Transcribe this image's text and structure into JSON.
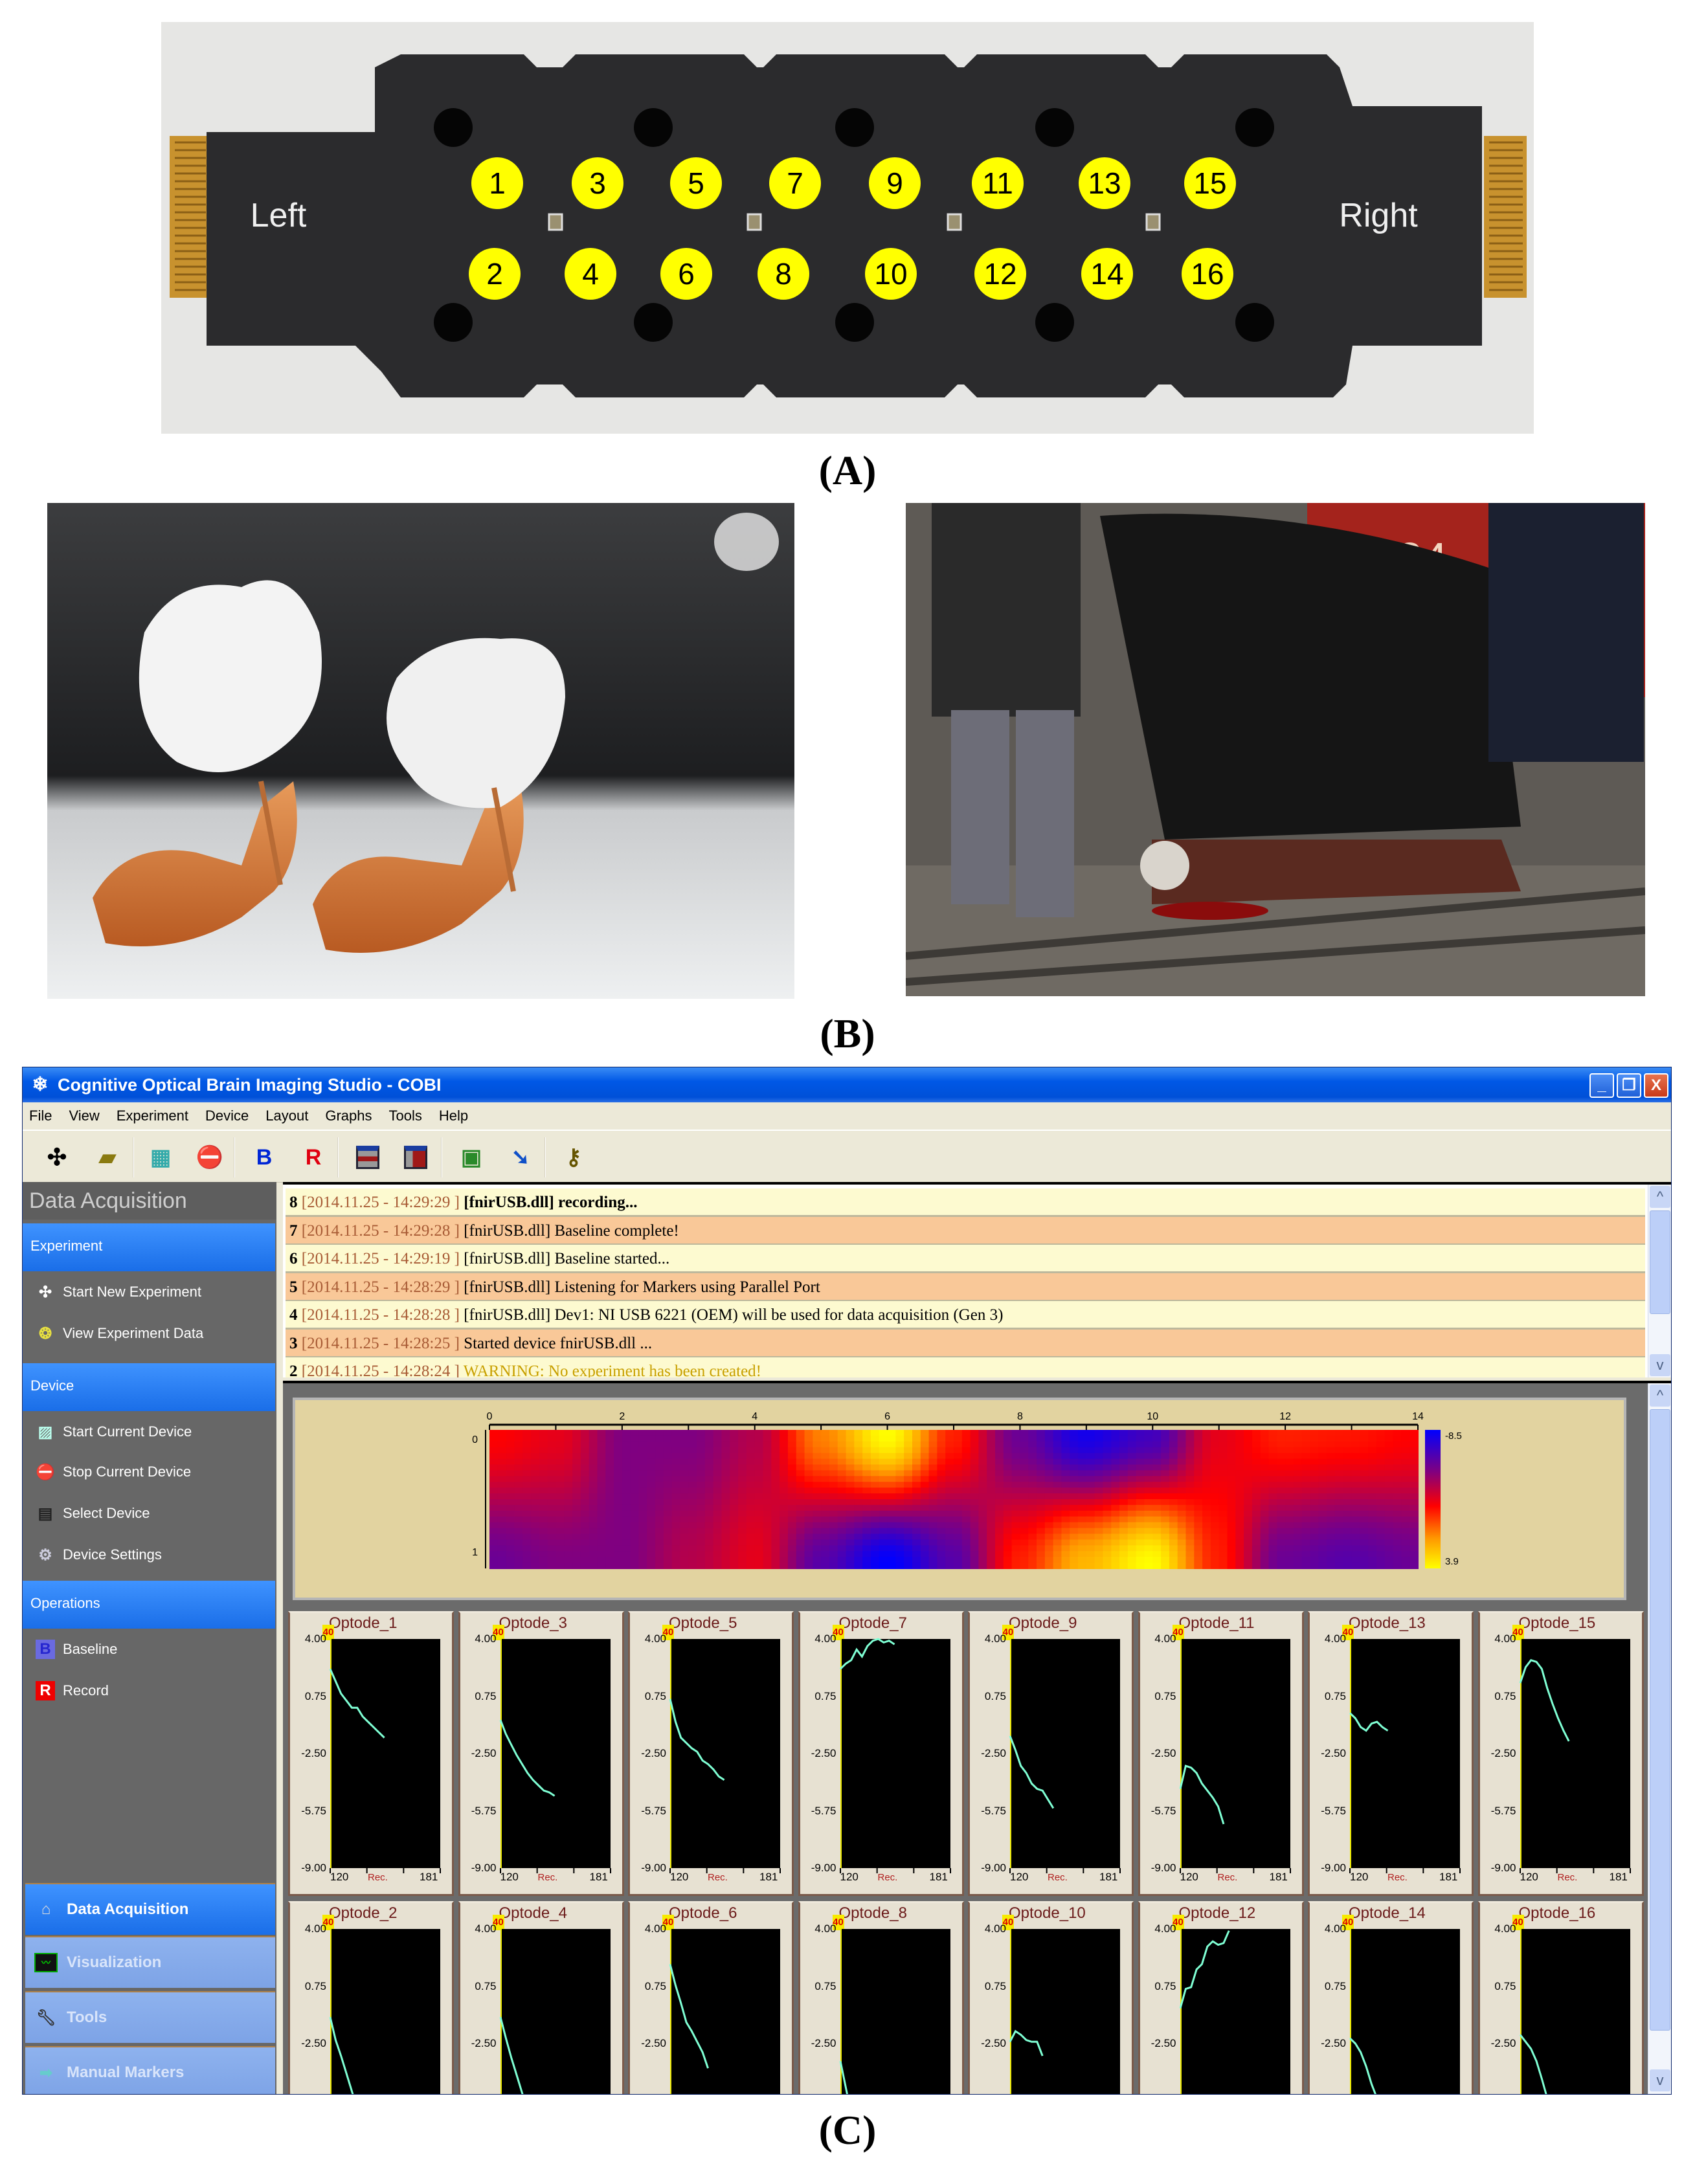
{
  "figure": {
    "labels": {
      "a": "(A)",
      "b": "(B)",
      "c": "(C)"
    }
  },
  "panel_a": {
    "left_label": "Left",
    "right_label": "Right",
    "top_row": [
      "1",
      "3",
      "5",
      "7",
      "9",
      "11",
      "13",
      "15"
    ],
    "bottom_row": [
      "2",
      "4",
      "6",
      "8",
      "10",
      "12",
      "14",
      "16"
    ],
    "pad_color": "#2b2b2d",
    "marker_color": "#ffff00"
  },
  "panel_b": {
    "left_photo": "shoes-photo",
    "right_photo": "accident-photo",
    "right_photo_sign": "284"
  },
  "app": {
    "title": "Cognitive Optical Brain Imaging Studio - COBI",
    "menu": [
      "File",
      "View",
      "Experiment",
      "Device",
      "Layout",
      "Graphs",
      "Tools",
      "Help"
    ],
    "toolbar": {
      "baseline_letter": "B",
      "record_letter": "R"
    },
    "window_buttons": {
      "minimize": "_",
      "restore": "❐",
      "close": "X"
    },
    "sidebar": {
      "header": "Data Acquisition",
      "sections": [
        {
          "title": "Experiment",
          "items": [
            "Start New Experiment",
            "View Experiment Data"
          ]
        },
        {
          "title": "Device",
          "items": [
            "Start Current Device",
            "Stop Current Device",
            "Select Device",
            "Device Settings"
          ]
        },
        {
          "title": "Operations",
          "items": [
            "Baseline",
            "Record"
          ]
        }
      ],
      "nav": [
        "Data Acquisition",
        "Visualization",
        "Tools",
        "Manual Markers"
      ]
    },
    "log": [
      {
        "n": "8",
        "ts": "[2014.11.25 - 14:29:29 ]",
        "msg": "[fnirUSB.dll] recording..."
      },
      {
        "n": "7",
        "ts": "[2014.11.25 - 14:29:28 ]",
        "msg": "[fnirUSB.dll] Baseline complete!"
      },
      {
        "n": "6",
        "ts": "[2014.11.25 - 14:29:19 ]",
        "msg": "[fnirUSB.dll] Baseline started..."
      },
      {
        "n": "5",
        "ts": "[2014.11.25 - 14:28:29 ]",
        "msg": "[fnirUSB.dll] Listening for Markers using Parallel Port"
      },
      {
        "n": "4",
        "ts": "[2014.11.25 - 14:28:28 ]",
        "msg": "[fnirUSB.dll] Dev1: NI USB 6221 (OEM) will be used for data acquisition (Gen 3)"
      },
      {
        "n": "3",
        "ts": "[2014.11.25 - 14:28:25 ]",
        "msg": "Started device fnirUSB.dll ..."
      },
      {
        "n": "2",
        "ts": "[2014.11.25 - 14:28:24 ]",
        "msg": "WARNING: No experiment has been created!"
      }
    ],
    "colors": {
      "log_yellow": "#fdfad0",
      "log_orange": "#f9c898",
      "accent": "#1f72ee",
      "trace": "#7fffd4"
    }
  },
  "chart_data": [
    {
      "type": "heatmap",
      "title": "",
      "x": [
        0,
        1,
        2,
        3,
        4,
        5,
        6,
        7,
        8,
        9,
        10,
        11,
        12,
        13,
        14
      ],
      "x_ticks": [
        "0",
        "2",
        "4",
        "6",
        "8",
        "10",
        "12",
        "14"
      ],
      "y_ticks": [
        "0",
        "1"
      ],
      "xlim": [
        0,
        14
      ],
      "ylim": [
        0,
        1
      ],
      "colorbar": {
        "min_label": "-8.5",
        "max_label": "3.9",
        "min": -8.5,
        "max": 3.9
      },
      "rows": [
        [
          -1.7,
          -2.3,
          -4.8,
          -4.8,
          -3.5,
          0.8,
          3.9,
          -1.1,
          -5.4,
          -7.9,
          -6.6,
          -2.3,
          -1.1,
          -1.3,
          -1.7
        ],
        [
          -5.4,
          -4.8,
          -4.8,
          -3.5,
          -2.3,
          -6.0,
          -8.5,
          -6.0,
          -1.1,
          2.0,
          3.9,
          -1.1,
          -5.4,
          -6.0,
          -5.4
        ]
      ]
    },
    {
      "type": "line",
      "title": "Optode traces",
      "xlabel": "Rec.",
      "xlim": [
        120,
        181
      ],
      "ylim": [
        -9,
        4
      ],
      "x_tick_labels": [
        "120",
        "181"
      ],
      "y_tick_labels": [
        "4.00",
        "0.75",
        "-2.50",
        "-5.75",
        "-9.00"
      ],
      "badge": "40",
      "x_start": 120,
      "x_step": 3,
      "series": [
        {
          "name": "Optode_1",
          "values": [
            2.3,
            1.6,
            0.9,
            0.5,
            0.1,
            0.1,
            -0.4,
            -0.7,
            -1.0,
            -1.3,
            -1.6
          ]
        },
        {
          "name": "Optode_3",
          "values": [
            -0.6,
            -1.4,
            -2.0,
            -2.6,
            -3.1,
            -3.6,
            -4.0,
            -4.3,
            -4.6,
            -4.7,
            -4.9
          ]
        },
        {
          "name": "Optode_5",
          "values": [
            0.6,
            -0.7,
            -1.6,
            -1.9,
            -2.2,
            -2.4,
            -2.9,
            -3.1,
            -3.4,
            -3.8,
            -4.0
          ]
        },
        {
          "name": "Optode_7",
          "values": [
            2.3,
            2.6,
            2.8,
            3.4,
            3.0,
            3.6,
            3.9,
            4.0,
            3.8,
            3.9,
            3.7
          ]
        },
        {
          "name": "Optode_9",
          "values": [
            -1.5,
            -2.3,
            -3.2,
            -3.6,
            -4.2,
            -4.5,
            -4.6,
            -5.1,
            -5.6
          ]
        },
        {
          "name": "Optode_11",
          "values": [
            -4.5,
            -3.2,
            -3.3,
            -3.6,
            -4.2,
            -4.6,
            -5.0,
            -5.5,
            -6.5
          ]
        },
        {
          "name": "Optode_13",
          "values": [
            -0.2,
            -0.5,
            -1.0,
            -1.2,
            -0.8,
            -0.7,
            -1.0,
            -1.2
          ]
        },
        {
          "name": "Optode_15",
          "values": [
            1.5,
            2.4,
            2.8,
            2.7,
            2.3,
            1.2,
            0.3,
            -0.5,
            -1.2,
            -1.8
          ]
        },
        {
          "name": "Optode_2",
          "values": [
            -1.0,
            -2.3,
            -3.2,
            -4.2,
            -5.2,
            -6.2,
            -7.2
          ]
        },
        {
          "name": "Optode_4",
          "values": [
            -1.0,
            -2.2,
            -3.3,
            -4.3,
            -5.3,
            -6.3,
            -7.3
          ]
        },
        {
          "name": "Optode_6",
          "values": [
            2.0,
            0.8,
            -0.2,
            -1.3,
            -1.8,
            -2.4,
            -3.0,
            -3.9
          ]
        },
        {
          "name": "Optode_8",
          "values": [
            -3.5,
            -5.0,
            -6.5,
            -8.0
          ]
        },
        {
          "name": "Optode_10",
          "values": [
            -2.4,
            -1.8,
            -2.0,
            -2.3,
            -2.4,
            -2.4,
            -3.2
          ]
        },
        {
          "name": "Optode_12",
          "values": [
            -0.5,
            0.6,
            0.7,
            1.7,
            2.0,
            3.0,
            3.3,
            3.1,
            3.2,
            3.9
          ]
        },
        {
          "name": "Optode_14",
          "values": [
            -2.2,
            -2.5,
            -3.0,
            -3.8,
            -4.8,
            -5.6,
            -6.5
          ]
        },
        {
          "name": "Optode_16",
          "values": [
            -2.0,
            -2.4,
            -2.8,
            -3.5,
            -4.5,
            -5.6,
            -6.6
          ]
        }
      ]
    }
  ]
}
